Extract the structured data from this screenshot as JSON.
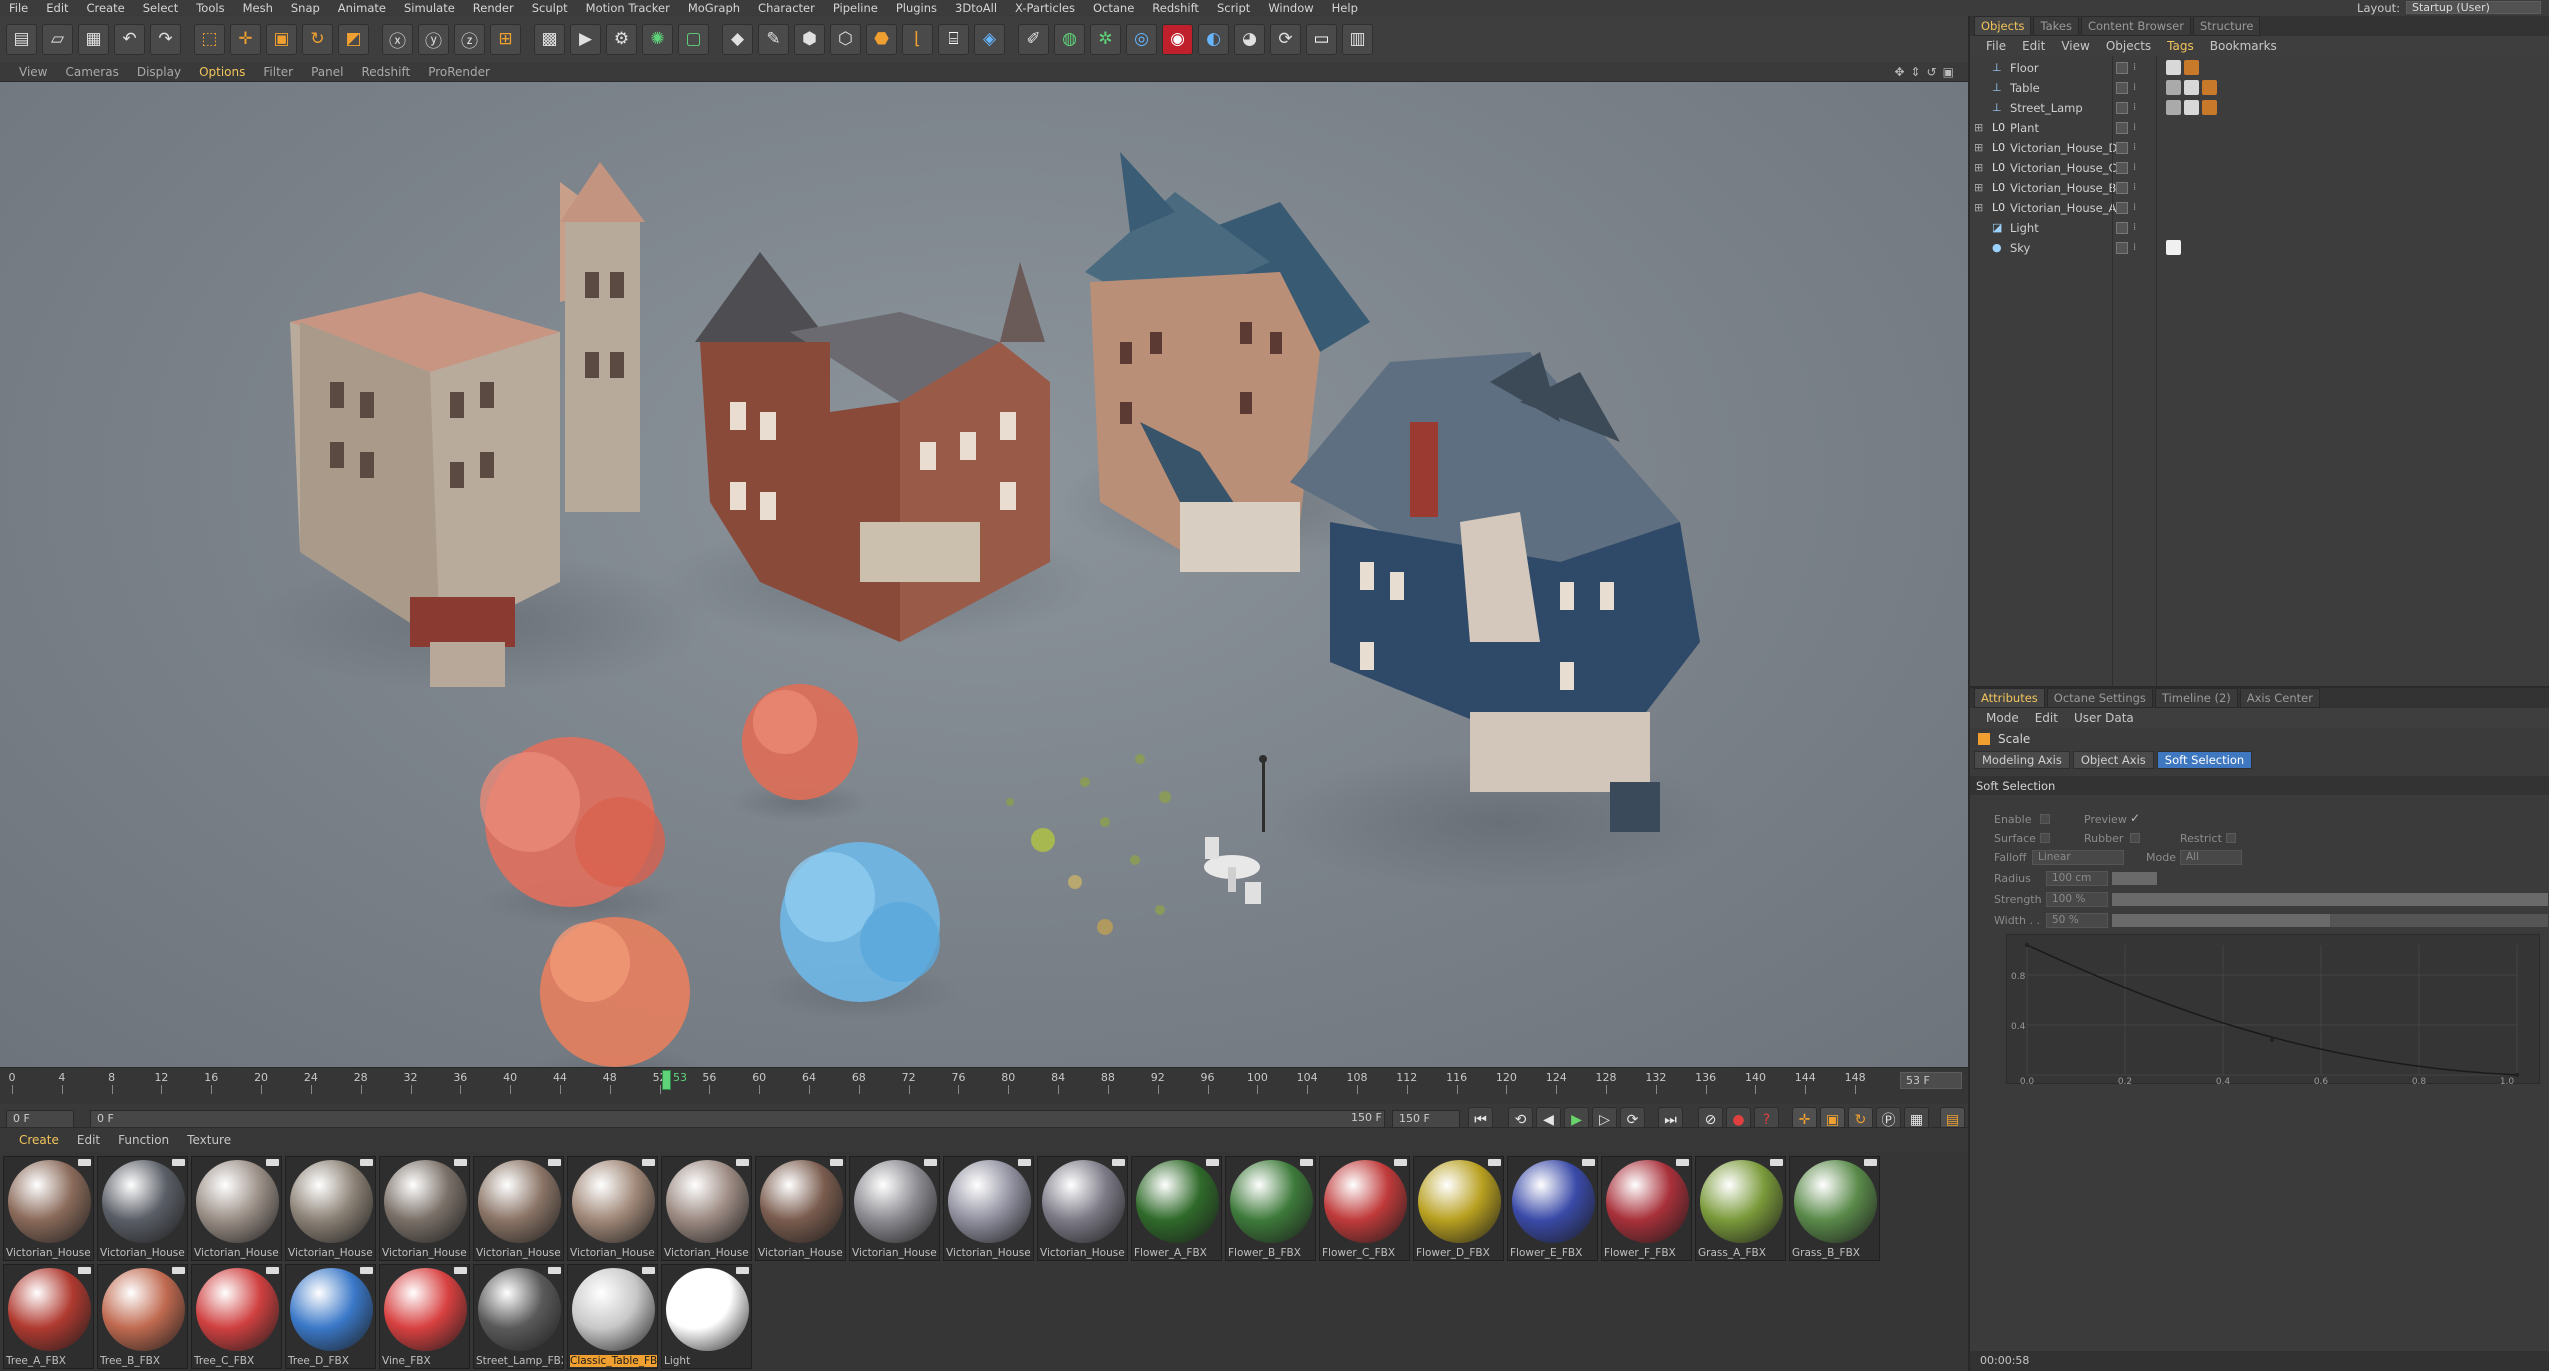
{
  "menubar": [
    "File",
    "Edit",
    "Create",
    "Select",
    "Tools",
    "Mesh",
    "Snap",
    "Animate",
    "Simulate",
    "Render",
    "Sculpt",
    "Motion Tracker",
    "MoGraph",
    "Character",
    "Pipeline",
    "Plugins",
    "3DtoAll",
    "X-Particles",
    "Octane",
    "Redshift",
    "Script",
    "Window",
    "Help"
  ],
  "layout": {
    "label": "Layout:",
    "value": "Startup (User)"
  },
  "viewport_menu": [
    "View",
    "Cameras",
    "Display",
    "Options",
    "Filter",
    "Panel",
    "Redshift",
    "ProRender"
  ],
  "timeline": {
    "ticks": [
      "0",
      "4",
      "8",
      "12",
      "16",
      "20",
      "24",
      "28",
      "32",
      "36",
      "40",
      "44",
      "48",
      "52",
      "56",
      "60",
      "64",
      "68",
      "72",
      "76",
      "80",
      "84",
      "88",
      "92",
      "96",
      "100",
      "104",
      "108",
      "112",
      "116",
      "120",
      "124",
      "128",
      "132",
      "136",
      "140",
      "144",
      "148"
    ],
    "current_frame_marker": "53",
    "end_field": "53 F",
    "start_field": "0 F",
    "range_start": "0 F",
    "range_end": "150 F",
    "max_field": "150 F"
  },
  "material_menu": [
    "Create",
    "Edit",
    "Function",
    "Texture"
  ],
  "materials_row1": [
    {
      "name": "Victorian_House",
      "color": "#8a6a5a"
    },
    {
      "name": "Victorian_House",
      "color": "#5a5e66"
    },
    {
      "name": "Victorian_House",
      "color": "#9a8e86"
    },
    {
      "name": "Victorian_House",
      "color": "#8c8276"
    },
    {
      "name": "Victorian_House",
      "color": "#7a7068"
    },
    {
      "name": "Victorian_House",
      "color": "#8a7466"
    },
    {
      "name": "Victorian_House",
      "color": "#a08878"
    },
    {
      "name": "Victorian_House",
      "color": "#9c8a82"
    },
    {
      "name": "Victorian_House",
      "color": "#7a5c4e"
    },
    {
      "name": "Victorian_House",
      "color": "#8a8a90"
    },
    {
      "name": "Victorian_House",
      "color": "#9090a0"
    },
    {
      "name": "Victorian_House",
      "color": "#7c7a86"
    },
    {
      "name": "Flower_A_FBX",
      "color": "#2f6a2a"
    },
    {
      "name": "Flower_B_FBX",
      "color": "#3d7a3a"
    },
    {
      "name": "Flower_C_FBX",
      "color": "#c03a3a"
    },
    {
      "name": "Flower_D_FBX",
      "color": "#b8a020"
    },
    {
      "name": "Flower_E_FBX",
      "color": "#3a4aa8"
    },
    {
      "name": "Flower_F_FBX",
      "color": "#a8303a"
    },
    {
      "name": "Grass_A_FBX",
      "color": "#7a9a3a"
    },
    {
      "name": "Grass_B_FBX",
      "color": "#5a8a4a"
    }
  ],
  "materials_row2": [
    {
      "name": "Tree_A_FBX",
      "color": "#b03a30"
    },
    {
      "name": "Tree_B_FBX",
      "color": "#c06a50"
    },
    {
      "name": "Tree_C_FBX",
      "color": "#d04040"
    },
    {
      "name": "Tree_D_FBX",
      "color": "#3a78c8"
    },
    {
      "name": "Vine_FBX",
      "color": "#d84040"
    },
    {
      "name": "Street_Lamp_FBX",
      "color": "#5a5a5a"
    },
    {
      "name": "Classic_Table_FBX",
      "color": "#c8c8c8",
      "selected": true
    },
    {
      "name": "Light",
      "color": "#ffffff"
    }
  ],
  "right_tabs": [
    "Objects",
    "Takes",
    "Content Browser",
    "Structure"
  ],
  "objects_menu": [
    "File",
    "Edit",
    "View",
    "Objects",
    "Tags",
    "Bookmarks"
  ],
  "objects": [
    {
      "name": "Floor",
      "icon": "floor-icon",
      "glyph": "⊥",
      "tags": [
        "#d8d8d8",
        "#c87a2a"
      ]
    },
    {
      "name": "Table",
      "icon": "null-icon",
      "glyph": "⊥",
      "tags": [
        "#aaaaaa",
        "#d8d8d8",
        "#c87a2a"
      ]
    },
    {
      "name": "Street_Lamp",
      "icon": "null-icon",
      "glyph": "⊥",
      "tags": [
        "#aaaaaa",
        "#d8d8d8",
        "#c87a2a"
      ]
    },
    {
      "name": "Plant",
      "icon": "group-icon",
      "glyph": "L0",
      "tags": []
    },
    {
      "name": "Victorian_House_D",
      "icon": "group-icon",
      "glyph": "L0",
      "tags": []
    },
    {
      "name": "Victorian_House_C",
      "icon": "group-icon",
      "glyph": "L0",
      "tags": []
    },
    {
      "name": "Victorian_House_B",
      "icon": "group-icon",
      "glyph": "L0",
      "tags": []
    },
    {
      "name": "Victorian_House_A",
      "icon": "group-icon",
      "glyph": "L0",
      "tags": []
    },
    {
      "name": "Light",
      "icon": "light-icon",
      "glyph": "◪",
      "tags": []
    },
    {
      "name": "Sky",
      "icon": "sky-icon",
      "glyph": "●",
      "tags": [
        "#f0f0f0"
      ]
    }
  ],
  "attr_tabs": [
    "Attributes",
    "Octane Settings",
    "Timeline (2)",
    "Axis Center"
  ],
  "attr_menu": [
    "Mode",
    "Edit",
    "User Data"
  ],
  "attr_title": "Scale",
  "attr_subtabs": [
    "Modeling Axis",
    "Object Axis",
    "Soft Selection"
  ],
  "soft_section": "Soft Selection",
  "params": {
    "enable": "Enable",
    "preview": "Preview",
    "surface": "Surface",
    "rubber": "Rubber",
    "restrict": "Restrict",
    "falloff": "Falloff",
    "falloff_val": "Linear",
    "mode": "Mode",
    "mode_val": "All",
    "radius": "Radius",
    "radius_val": "100 cm",
    "strength": "Strength",
    "strength_val": "100 %",
    "width": "Width . .",
    "width_val": "50 %"
  },
  "graph": {
    "y_labels": [
      "0.8",
      "0.4"
    ],
    "x_labels": [
      "0.0",
      "0.2",
      "0.4",
      "0.6",
      "0.8",
      "1.0"
    ]
  },
  "status_time": "00:00:58"
}
